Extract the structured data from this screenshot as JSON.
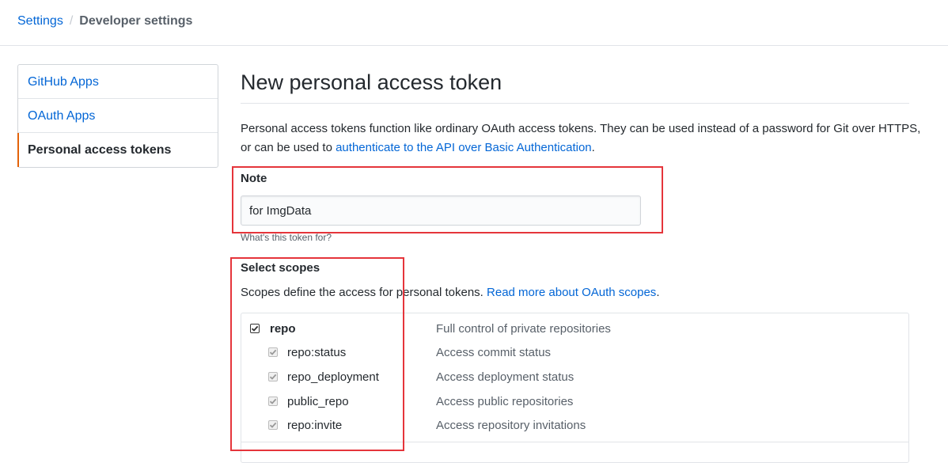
{
  "breadcrumb": {
    "root": "Settings",
    "separator": "/",
    "current": "Developer settings"
  },
  "sidebar": {
    "items": [
      {
        "label": "GitHub Apps",
        "selected": false
      },
      {
        "label": "OAuth Apps",
        "selected": false
      },
      {
        "label": "Personal access tokens",
        "selected": true
      }
    ]
  },
  "main": {
    "title": "New personal access token",
    "intro_text": "Personal access tokens function like ordinary OAuth access tokens. They can be used instead of a password for Git over HTTPS, or can be used to ",
    "intro_link": "authenticate to the API over Basic Authentication",
    "intro_end": ".",
    "note": {
      "label": "Note",
      "value": "for ImgData",
      "hint": "What's this token for?"
    },
    "scopes": {
      "label": "Select scopes",
      "description": "Scopes define the access for personal tokens. ",
      "description_link": "Read more about OAuth scopes",
      "description_end": ".",
      "items": [
        {
          "name": "repo",
          "description": "Full control of private repositories",
          "checked": true
        },
        {
          "name": "repo:status",
          "description": "Access commit status",
          "checked": true
        },
        {
          "name": "repo_deployment",
          "description": "Access deployment status",
          "checked": true
        },
        {
          "name": "public_repo",
          "description": "Access public repositories",
          "checked": true
        },
        {
          "name": "repo:invite",
          "description": "Access repository invitations",
          "checked": true
        }
      ]
    }
  },
  "colors": {
    "link": "#0366d6",
    "selected_accent": "#e36209",
    "annotation": "#e5353b"
  }
}
